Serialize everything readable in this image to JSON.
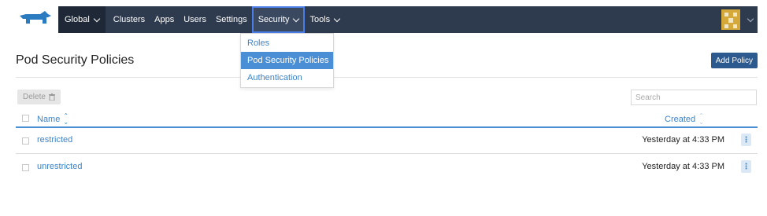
{
  "nav": {
    "logo_icon": "rancher-logo-icon",
    "global_label": "Global",
    "items": [
      "Clusters",
      "Apps",
      "Users",
      "Settings"
    ],
    "security_label": "Security",
    "tools_label": "Tools",
    "avatar_icon": "user-avatar-icon",
    "colors": {
      "bar": "#2e3a4d",
      "global_bg": "#1f2836",
      "active_border": "#4a7de6"
    }
  },
  "security_menu": {
    "items": [
      "Roles",
      "Pod Security Policies",
      "Authentication"
    ],
    "selected": "Pod Security Policies"
  },
  "page": {
    "title": "Pod Security Policies",
    "add_button": "Add Policy",
    "delete_button": "Delete",
    "delete_icon": "trash-icon",
    "search_placeholder": "Search"
  },
  "table": {
    "columns": {
      "name": "Name",
      "created": "Created"
    },
    "rows": [
      {
        "name": "restricted",
        "created": "Yesterday at 4:33 PM"
      },
      {
        "name": "unrestricted",
        "created": "Yesterday at 4:33 PM"
      }
    ]
  },
  "colors": {
    "link": "#3d83c7",
    "primary_button": "#2c5a8f",
    "selected_menu": "#4a8fd6"
  }
}
